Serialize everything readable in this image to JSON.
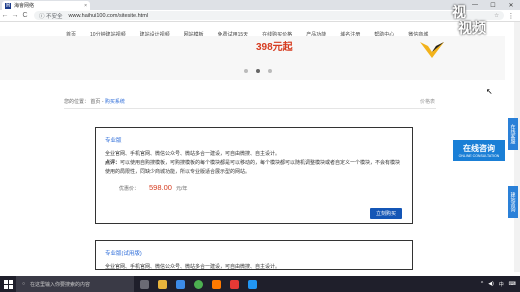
{
  "browser": {
    "tab_title": "海會网络",
    "tab_close": "×",
    "window_controls": [
      "—",
      "☐",
      "✕"
    ],
    "back": "←",
    "forward": "→",
    "reload": "C",
    "security_label": "ⓘ 不安全",
    "url": "www.haihui100.com/sitesite.html",
    "star": "☆",
    "menu": "⋮"
  },
  "site_nav": {
    "items": [
      "首页",
      "10分钟建站视频",
      "建站设计视频",
      "网站模板",
      "免费试用15天",
      "在线购买价格",
      "产品功能",
      "域名注册",
      "帮助中心",
      "微信商城"
    ]
  },
  "banner": {
    "price_text": "398元起"
  },
  "watermark": {
    "line1": "视",
    "line2": "视频"
  },
  "breadcrumb": {
    "prefix": "您的位置：",
    "home": "首页",
    "sep": " - ",
    "current": "购买系统",
    "right_text": "价格表"
  },
  "card1": {
    "title": "专业版",
    "desc_line": "全业官网、手机官网、微信公众号、微站多合一建设，可自由微搜、自主设计。",
    "point_label": "点评：",
    "point_text": "可以使用自购搜模板，可购搜模板的每个模块都是可以移动的，每个模块都可以随机调整模块或者自定义一个模块，不会有模块使用的局限性，同缺少商城功能，所以专业版适合展示型的网站。",
    "price_label": "优惠价：",
    "price_value": "598.00",
    "price_unit": "元/年",
    "buy_button": "立刻购买"
  },
  "card2": {
    "title": "专业版(试用版)",
    "desc_line": "全业官网、手机官网、微信公众号、微站多合一建设，可自由微搜、自主设计。"
  },
  "consult": {
    "title": "在线咨询",
    "sub": "ONLINE CONSULTATION"
  },
  "side_tabs": [
    "在线客服",
    "建站咨询"
  ],
  "taskbar": {
    "search_placeholder": "在这里输入你要搜索的内容"
  },
  "tray": {
    "items": [
      "^",
      "◀)",
      "中",
      "⌨"
    ]
  },
  "colors": {
    "accent_blue": "#1456b6",
    "price_red": "#d63b1f",
    "link_blue": "#2a6ad8"
  }
}
